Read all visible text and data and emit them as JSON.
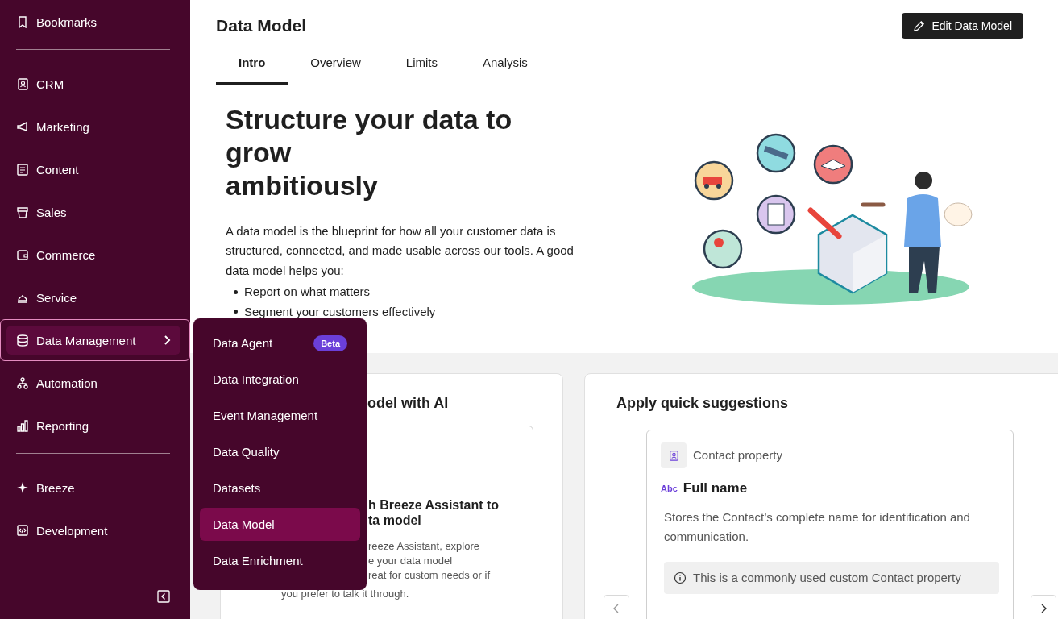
{
  "sidebar": {
    "groups": [
      [
        {
          "label": "Bookmarks",
          "selected": false,
          "submenu": false
        }
      ],
      [
        {
          "label": "CRM",
          "selected": false,
          "submenu": false
        },
        {
          "label": "Marketing",
          "selected": false,
          "submenu": false
        },
        {
          "label": "Content",
          "selected": false,
          "submenu": false
        },
        {
          "label": "Sales",
          "selected": false,
          "submenu": false
        },
        {
          "label": "Commerce",
          "selected": false,
          "submenu": false
        },
        {
          "label": "Service",
          "selected": false,
          "submenu": false
        },
        {
          "label": "Data Management",
          "selected": true,
          "submenu": true
        },
        {
          "label": "Automation",
          "selected": false,
          "submenu": false
        },
        {
          "label": "Reporting",
          "selected": false,
          "submenu": false
        }
      ],
      [
        {
          "label": "Breeze",
          "selected": false,
          "submenu": false
        },
        {
          "label": "Development",
          "selected": false,
          "submenu": false
        }
      ]
    ]
  },
  "flyout_menu": {
    "items": [
      {
        "label": "Data Agent",
        "badge": "Beta",
        "selected": false
      },
      {
        "label": "Data Integration",
        "selected": false
      },
      {
        "label": "Event Management",
        "selected": false
      },
      {
        "label": "Data Quality",
        "selected": false
      },
      {
        "label": "Datasets",
        "selected": false
      },
      {
        "label": "Data Model",
        "selected": true
      },
      {
        "label": "Data Enrichment",
        "selected": false
      }
    ]
  },
  "header": {
    "title": "Data Model",
    "edit_button": "Edit Data Model"
  },
  "tabs": [
    {
      "label": "Intro",
      "selected": true
    },
    {
      "label": "Overview",
      "selected": false
    },
    {
      "label": "Limits",
      "selected": false
    },
    {
      "label": "Analysis",
      "selected": false
    }
  ],
  "hero": {
    "title_lines": [
      "Structure your data to",
      "grow",
      "ambitiously"
    ],
    "description": "A data model is the blueprint for how all your customer data is structured, connected, and made usable across our tools. A good data model helps you:",
    "bullets": [
      "Report on what matters",
      "Segment your customers effectively"
    ]
  },
  "ai_card": {
    "title": "odel with AI",
    "inner_title_lines": [
      "h Breeze Assistant to",
      "ta model"
    ],
    "inner_text_lines": [
      "reeze Assistant, explore",
      "e your data model",
      "reat for custom needs or if",
      "you prefer to talk it through."
    ]
  },
  "suggestions_card": {
    "title": "Apply quick suggestions",
    "object_type": "Contact property",
    "type_tag": "Abc",
    "property_name": "Full name",
    "description": "Stores the Contact’s complete name for identification and communication.",
    "note": "This is a commonly used custom Contact property"
  }
}
